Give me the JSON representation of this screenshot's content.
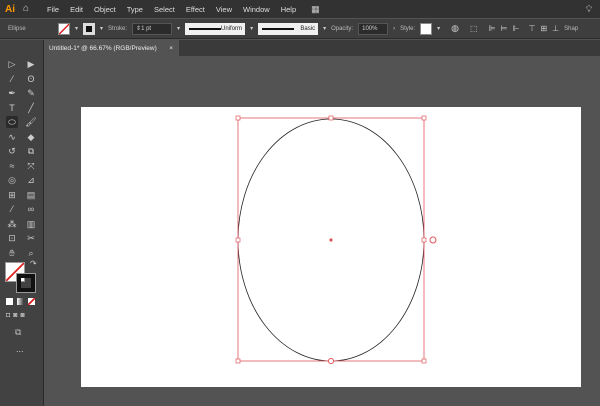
{
  "app": {
    "logo": "Ai",
    "menus": [
      "File",
      "Edit",
      "Object",
      "Type",
      "Select",
      "Effect",
      "View",
      "Window",
      "Help"
    ]
  },
  "control": {
    "tool_name": "Ellipse",
    "stroke_label": "Stroke:",
    "stroke_value": "1 pt",
    "profile": "Uniform",
    "brush": "Basic",
    "opacity_label": "Opacity:",
    "opacity_value": "100%",
    "style_label": "Style:",
    "shape_label": "Shap"
  },
  "document": {
    "tab_title": "Untitled-1* @ 66.67% (RGB/Preview)",
    "close": "×"
  },
  "toolbar": {
    "tools": [
      "selection",
      "direct-selection",
      "magic-wand",
      "lasso",
      "pen",
      "curvature",
      "type",
      "line",
      "ellipse",
      "paintbrush",
      "shaper",
      "eraser",
      "rotate",
      "scale",
      "warp",
      "free-transform",
      "shape-builder",
      "perspective-grid",
      "mesh",
      "gradient",
      "eyedropper",
      "blend",
      "symbol-sprayer",
      "column-graph",
      "artboard",
      "slice",
      "hand",
      "zoom"
    ],
    "more": "..."
  },
  "colors": {
    "selection": "#e0555a",
    "fill": "#ffffff",
    "stroke": "#000000",
    "accent": "#ff9a00"
  }
}
